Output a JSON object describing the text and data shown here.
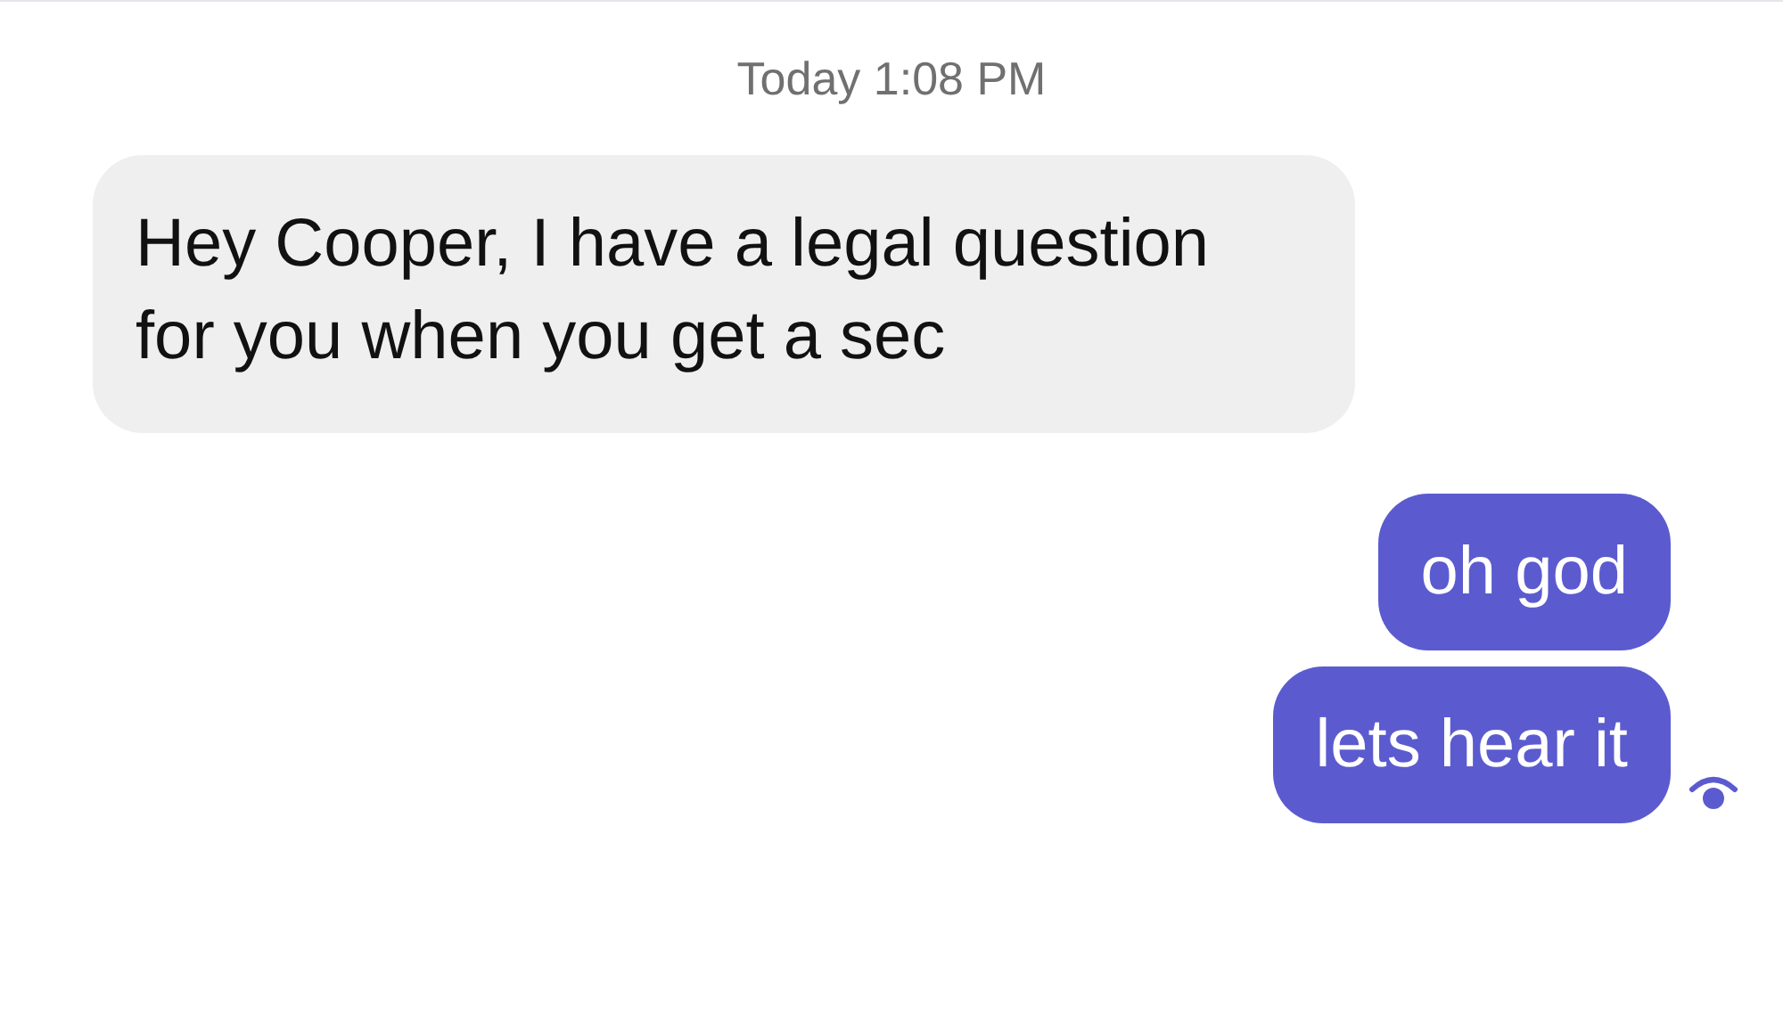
{
  "timestamp": "Today 1:08 PM",
  "messages": [
    {
      "kind": "incoming",
      "text": "Hey Cooper, I have a legal question for you when you get a sec"
    },
    {
      "kind": "outgoing",
      "text": "oh god"
    },
    {
      "kind": "outgoing",
      "text": "lets hear it"
    }
  ]
}
